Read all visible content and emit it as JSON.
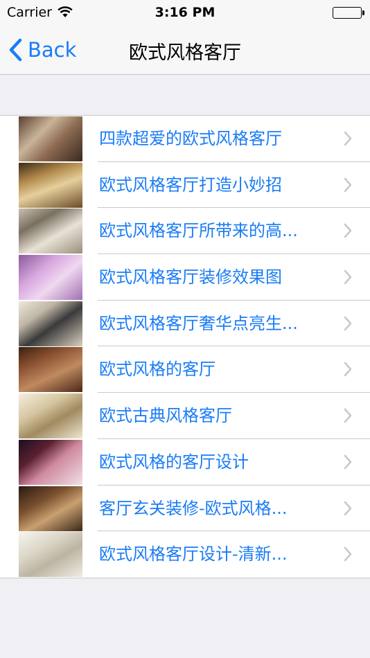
{
  "status_bar": {
    "carrier": "Carrier",
    "time": "3:16 PM"
  },
  "nav": {
    "back_label": "Back",
    "title": "欧式风格客厅"
  },
  "accent_color": "#1a7cf5",
  "items": [
    {
      "title": "四款超爱的欧式风格客厅"
    },
    {
      "title": "欧式风格客厅打造小妙招"
    },
    {
      "title": "欧式风格客厅所带来的高..."
    },
    {
      "title": "欧式风格客厅装修效果图"
    },
    {
      "title": "欧式风格客厅奢华点亮生..."
    },
    {
      "title": "欧式风格的客厅"
    },
    {
      "title": "欧式古典风格客厅"
    },
    {
      "title": "欧式风格的客厅设计"
    },
    {
      "title": "客厅玄关装修-欧式风格..."
    },
    {
      "title": "欧式风格客厅设计-清新..."
    }
  ]
}
